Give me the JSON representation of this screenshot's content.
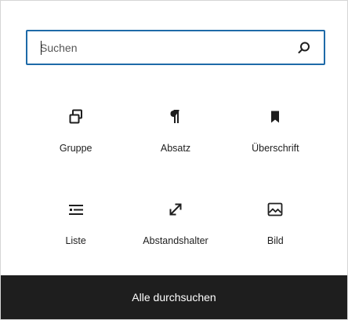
{
  "search": {
    "placeholder": "Suchen",
    "value": "",
    "icon": "search-icon"
  },
  "blocks": [
    {
      "label": "Gruppe",
      "icon": "group-icon"
    },
    {
      "label": "Absatz",
      "icon": "paragraph-icon"
    },
    {
      "label": "Überschrift",
      "icon": "bookmark-heading-icon"
    },
    {
      "label": "Liste",
      "icon": "list-icon"
    },
    {
      "label": "Abstandshalter",
      "icon": "resize-arrows-icon"
    },
    {
      "label": "Bild",
      "icon": "image-icon"
    }
  ],
  "footer": {
    "label": "Alle durchsuchen"
  },
  "colors": {
    "focus_border": "#1e6aa8",
    "footer_bg": "#1e1e1e",
    "text": "#1e1e1e"
  }
}
